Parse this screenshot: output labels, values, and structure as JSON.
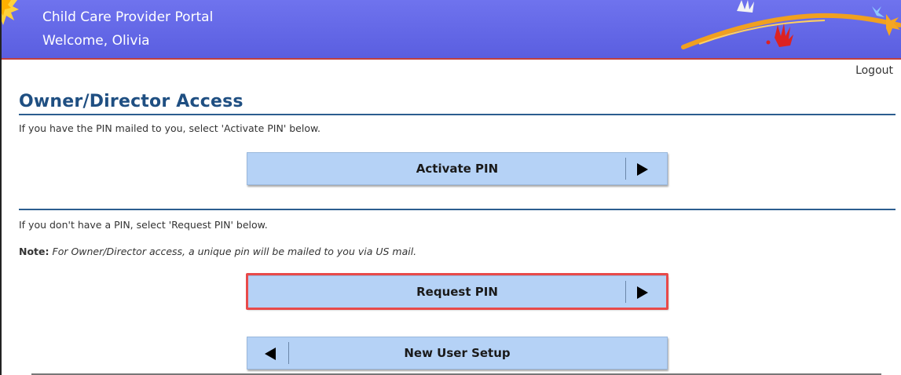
{
  "header": {
    "app_title": "Child Care Provider Portal",
    "welcome": "Welcome, Olivia"
  },
  "nav": {
    "logout": "Logout"
  },
  "main": {
    "title": "Owner/Director Access",
    "activate_instruction": "If you have the PIN mailed to you, select 'Activate PIN' below.",
    "request_instruction": "If you don't have a PIN, select 'Request PIN' below.",
    "note_label": "Note:",
    "note_text": "For Owner/Director access, a unique pin will be mailed to you via US mail."
  },
  "buttons": {
    "activate_pin": "Activate PIN",
    "request_pin": "Request PIN",
    "new_user_setup": "New User Setup"
  },
  "icons": {
    "activate_arrow": "arrow-right-icon",
    "request_arrow": "arrow-right-icon",
    "back_arrow": "arrow-left-icon"
  },
  "colors": {
    "header_bg": "#6f73ee",
    "title_color": "#1f4f82",
    "button_bg": "#b5d2f6",
    "highlight": "#e84a4a"
  }
}
